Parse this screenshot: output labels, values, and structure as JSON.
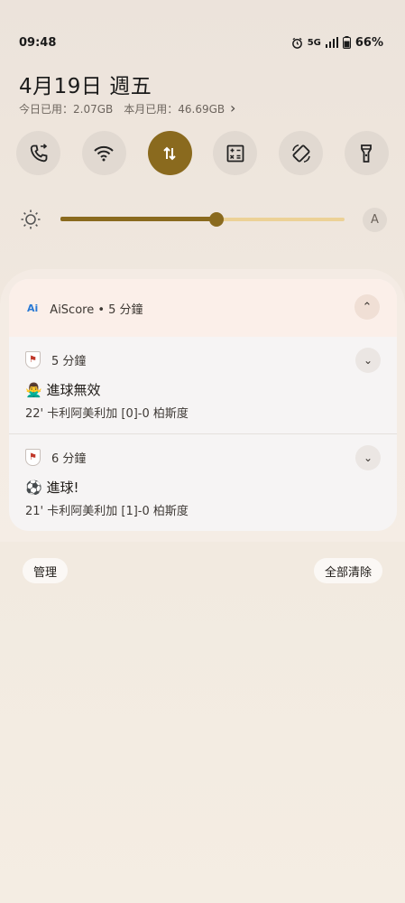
{
  "status_bar": {
    "time": "09:48",
    "network": "5G",
    "battery": "66%",
    "icons": [
      "alarm-icon",
      "signal-icon",
      "battery-icon"
    ]
  },
  "header": {
    "date": "4月19日 週五",
    "usage_today": "今日已用：2.07GB",
    "usage_month": "本月已用：46.69GB"
  },
  "quick_tiles": [
    {
      "name": "call-forward-icon",
      "active": false
    },
    {
      "name": "wifi-icon",
      "active": false
    },
    {
      "name": "mobile-data-icon",
      "active": true
    },
    {
      "name": "calculator-icon",
      "active": false
    },
    {
      "name": "auto-rotate-icon",
      "active": false
    },
    {
      "name": "flashlight-icon",
      "active": false
    }
  ],
  "brightness": {
    "level": 0.55,
    "auto_label": "A"
  },
  "app": {
    "logo": "Ai",
    "title": "AiScore • 5 分鐘"
  },
  "notifications": [
    {
      "time": "5 分鐘",
      "emoji": "🙅‍♂️",
      "title": "進球無效",
      "text": "22' 卡利阿美利加 [0]-0 柏斯度"
    },
    {
      "time": "6 分鐘",
      "emoji": "⚽",
      "title": "進球!",
      "text": "21' 卡利阿美利加 [1]-0 柏斯度"
    }
  ],
  "footer": {
    "manage": "管理",
    "clear_all": "全部清除"
  },
  "colors": {
    "accent": "#8a6a1e",
    "track": "#ecd196",
    "background": "#f1e9df"
  }
}
